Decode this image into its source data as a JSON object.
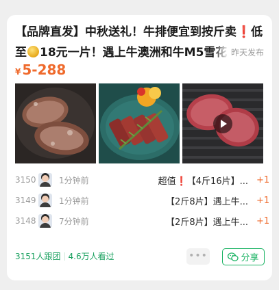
{
  "post": {
    "title_part1": "【品牌直发】中秋送礼！牛排便宜到按斤卖",
    "title_mark": "❗",
    "title_part2": "低至",
    "title_part3": "18元一片！遇上牛澳洲和牛M5雪花",
    "posted_time": "昨天发布",
    "price_currency": "¥",
    "price_range": "5-288",
    "photos": [
      {
        "icon": "steak-in-pan-photo"
      },
      {
        "icon": "sliced-steak-plate-photo"
      },
      {
        "icon": "grilled-steak-video",
        "video": true
      }
    ]
  },
  "orders": [
    {
      "no": "3150",
      "time": "1分钟前",
      "prefix": "超值",
      "mark": "❗",
      "item": "【4斤16片】...",
      "qty": "+1"
    },
    {
      "no": "3149",
      "time": "1分钟前",
      "prefix": "",
      "mark": "",
      "item": "【2斤8片】遇上牛...",
      "qty": "+1"
    },
    {
      "no": "3148",
      "time": "7分钟前",
      "prefix": "",
      "mark": "",
      "item": "【2斤8片】遇上牛...",
      "qty": "+1"
    }
  ],
  "stats": {
    "joined": "3151人跟团",
    "viewed": "4.6万人看过"
  },
  "actions": {
    "more_label": "•••",
    "share_label": "分享"
  },
  "colors": {
    "price": "#ef6a2c",
    "green": "#14b15f",
    "mark": "#c9302c"
  }
}
